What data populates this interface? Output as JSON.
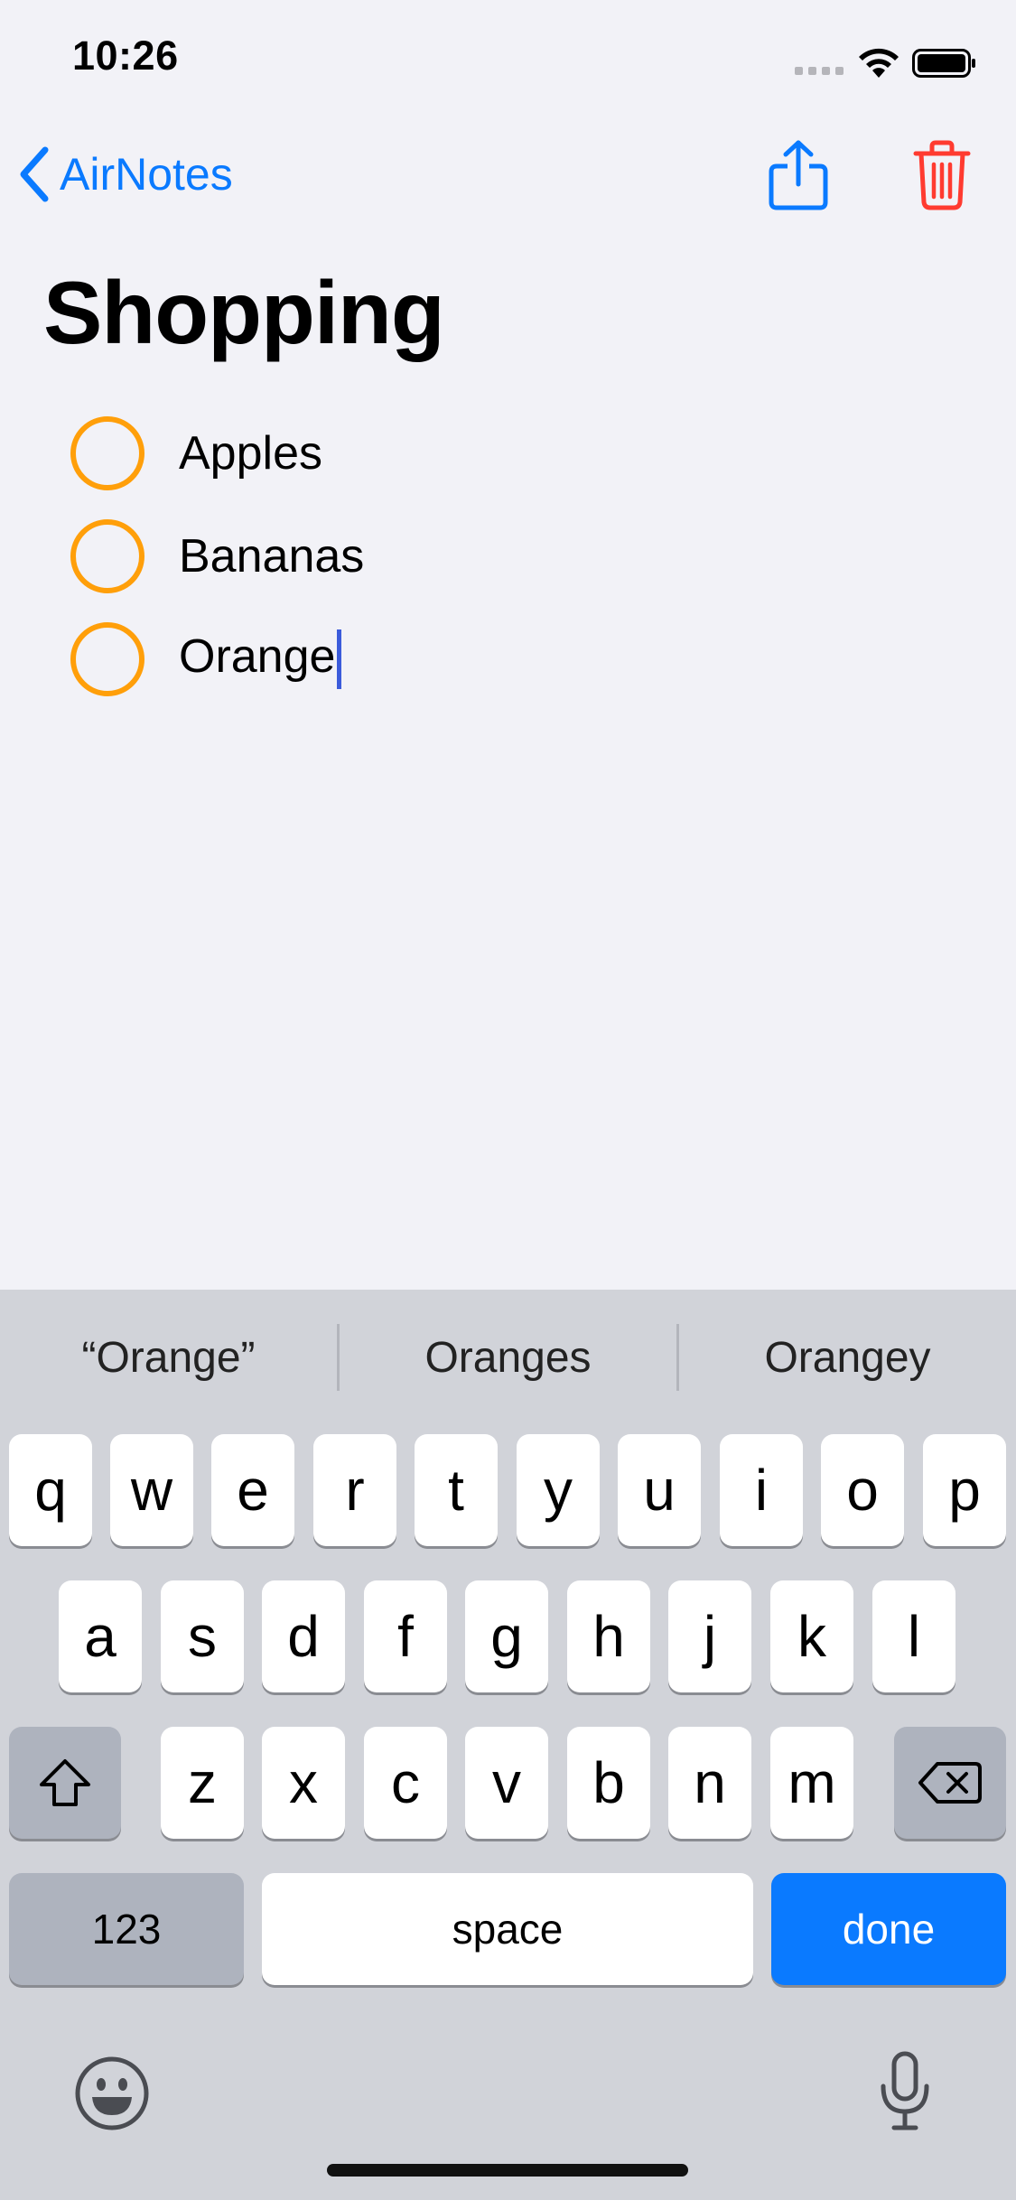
{
  "status_bar": {
    "time": "10:26"
  },
  "nav": {
    "back_label": "AirNotes"
  },
  "note": {
    "title": "Shopping",
    "items": [
      {
        "text": "Apples"
      },
      {
        "text": "Bananas"
      },
      {
        "text": "Orange"
      }
    ]
  },
  "keyboard": {
    "suggestions": [
      "“Orange”",
      "Oranges",
      "Orangey"
    ],
    "row1": [
      "q",
      "w",
      "e",
      "r",
      "t",
      "y",
      "u",
      "i",
      "o",
      "p"
    ],
    "row2": [
      "a",
      "s",
      "d",
      "f",
      "g",
      "h",
      "j",
      "k",
      "l"
    ],
    "row3": [
      "z",
      "x",
      "c",
      "v",
      "b",
      "n",
      "m"
    ],
    "numbers_label": "123",
    "space_label": "space",
    "done_label": "done"
  },
  "colors": {
    "accent": "#0a7aff",
    "checkbox": "#ff9f0a",
    "delete": "#ff3b30",
    "background": "#f2f2f7"
  }
}
